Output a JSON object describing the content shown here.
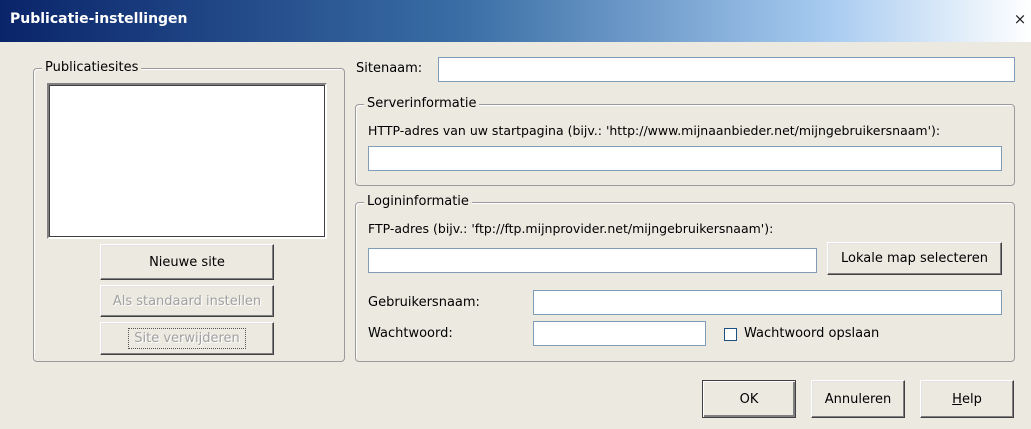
{
  "window": {
    "title": "Publicatie-instellingen",
    "close_glyph": "×"
  },
  "sites": {
    "group_label": "Publicatiesites",
    "items": [],
    "new_site": "Nieuwe site",
    "set_default": "Als standaard instellen",
    "remove_site": "Site verwijderen"
  },
  "sitename": {
    "label": "Sitenaam:",
    "value": ""
  },
  "server": {
    "group_label": "Serverinformatie",
    "http_label": "HTTP-adres van uw startpagina (bijv.: 'http://www.mijnaanbieder.net/mijngebruikersnaam'):",
    "http_value": ""
  },
  "login": {
    "group_label": "Logininformatie",
    "ftp_label": "FTP-adres (bijv.: 'ftp://ftp.mijnprovider.net/mijngebruikersnaam'):",
    "ftp_value": "",
    "select_folder": "Lokale map selecteren",
    "username_label": "Gebruikersnaam:",
    "username_value": "",
    "password_label": "Wachtwoord:",
    "password_value": "",
    "save_password_label": "Wachtwoord opslaan",
    "save_password_checked": false
  },
  "footer": {
    "ok": "OK",
    "cancel": "Annuleren",
    "help_first": "H",
    "help_rest": "elp"
  }
}
